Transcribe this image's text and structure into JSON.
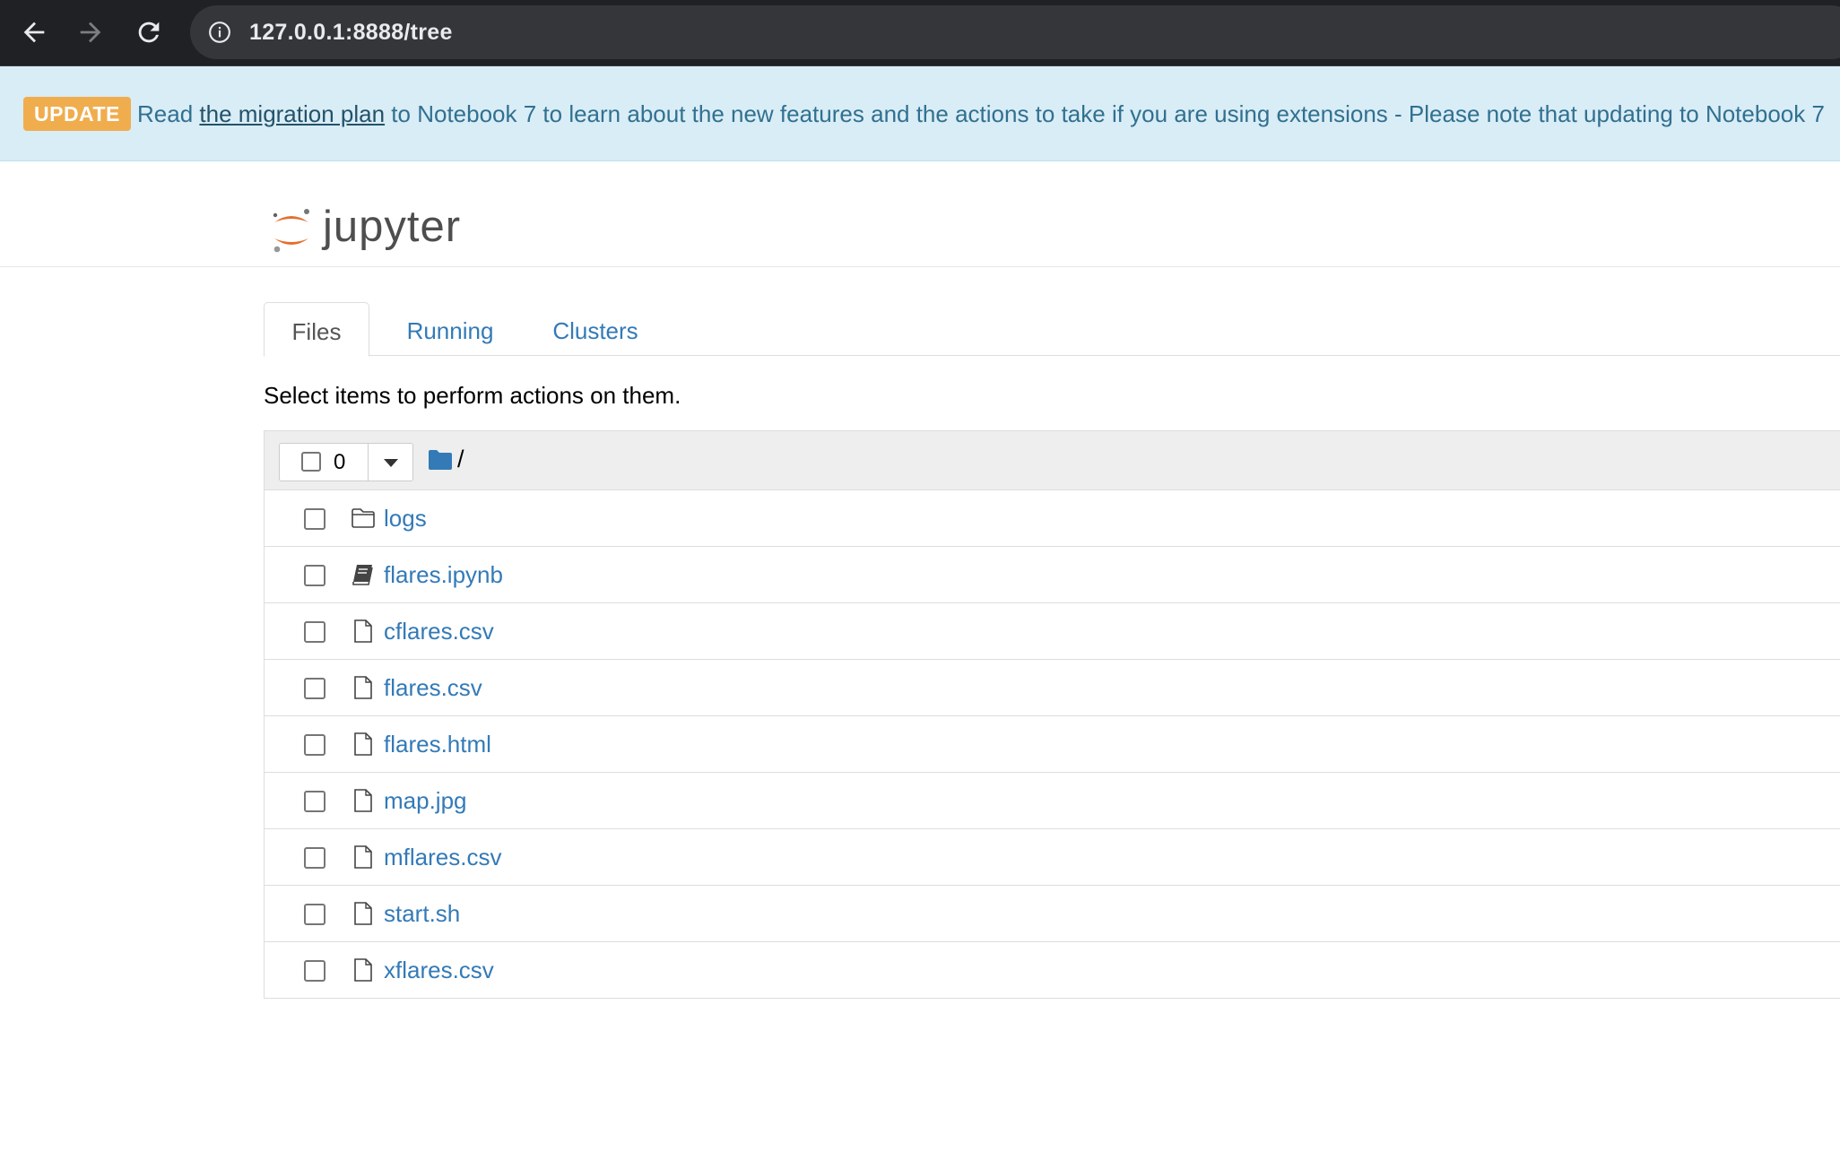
{
  "browser": {
    "url": "127.0.0.1:8888/tree"
  },
  "banner": {
    "badge": "UPDATE",
    "text_before": "Read ",
    "link": "the migration plan",
    "text_after": " to Notebook 7 to learn about the new features and the actions to take if you are using extensions - Please note that updating to Notebook 7"
  },
  "header": {
    "logo_text": "jupyter"
  },
  "tabs": [
    {
      "label": "Files",
      "active": true
    },
    {
      "label": "Running",
      "active": false
    },
    {
      "label": "Clusters",
      "active": false
    }
  ],
  "instructions": "Select items to perform actions on them.",
  "list_header": {
    "selected_count": "0",
    "breadcrumb": "/"
  },
  "files": [
    {
      "name": "logs",
      "icon": "folder-icon"
    },
    {
      "name": "flares.ipynb",
      "icon": "notebook-icon"
    },
    {
      "name": "cflares.csv",
      "icon": "file-icon"
    },
    {
      "name": "flares.csv",
      "icon": "file-icon"
    },
    {
      "name": "flares.html",
      "icon": "file-icon"
    },
    {
      "name": "map.jpg",
      "icon": "file-icon"
    },
    {
      "name": "mflares.csv",
      "icon": "file-icon"
    },
    {
      "name": "start.sh",
      "icon": "file-icon"
    },
    {
      "name": "xflares.csv",
      "icon": "file-icon"
    }
  ],
  "colors": {
    "chrome": "#202124",
    "banner_bg": "#d9edf7",
    "badge": "#f0ad4e",
    "link": "#337ab7",
    "jupyter_orange": "#e46e2e"
  }
}
